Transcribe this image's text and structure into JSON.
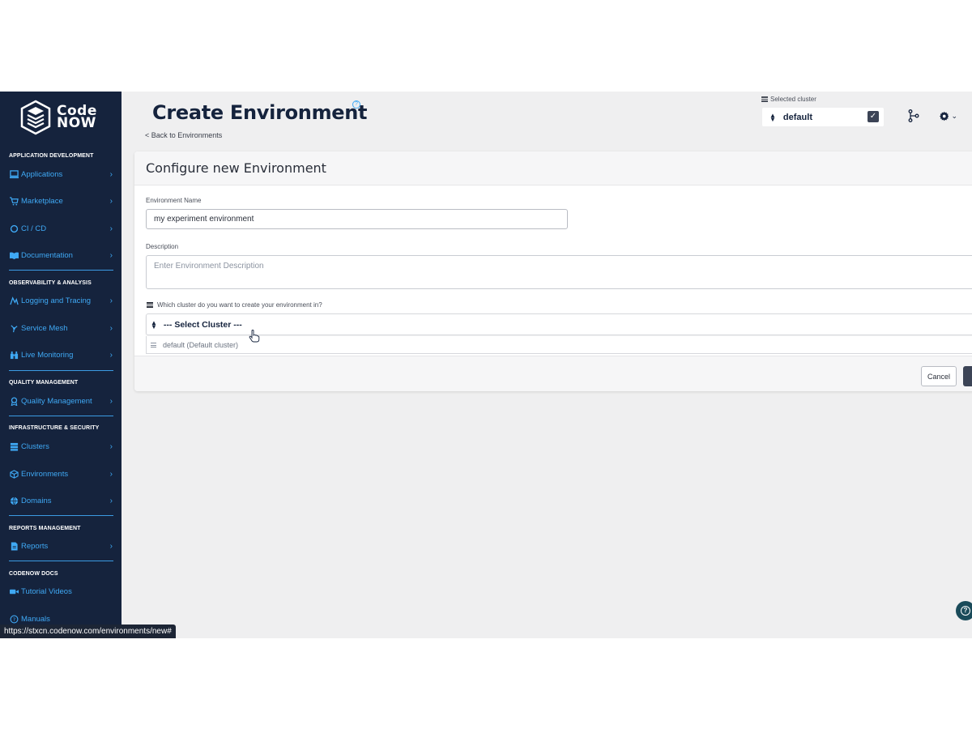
{
  "brand": {
    "line1": "Code",
    "line2": "NOW"
  },
  "sidebar": {
    "sections": [
      {
        "title": "APPLICATION DEVELOPMENT"
      },
      {
        "title": "OBSERVABILITY & ANALYSIS"
      },
      {
        "title": "QUALITY MANAGEMENT"
      },
      {
        "title": "INFRASTRUCTURE & SECURITY"
      },
      {
        "title": "REPORTS MANAGEMENT"
      },
      {
        "title": "CODENOW DOCS"
      }
    ],
    "items": [
      {
        "label": "Applications",
        "icon": "applications-icon"
      },
      {
        "label": "Marketplace",
        "icon": "cart-icon"
      },
      {
        "label": "CI / CD",
        "icon": "cicd-icon"
      },
      {
        "label": "Documentation",
        "icon": "book-icon"
      },
      {
        "label": "Logging and Tracing",
        "icon": "logging-icon"
      },
      {
        "label": "Service Mesh",
        "icon": "mesh-icon"
      },
      {
        "label": "Live Monitoring",
        "icon": "binoculars-icon"
      },
      {
        "label": "Quality Management",
        "icon": "quality-icon"
      },
      {
        "label": "Clusters",
        "icon": "server-icon"
      },
      {
        "label": "Environments",
        "icon": "box-icon"
      },
      {
        "label": "Domains",
        "icon": "globe-icon"
      },
      {
        "label": "Reports",
        "icon": "report-icon"
      },
      {
        "label": "Tutorial Videos",
        "icon": "video-icon"
      },
      {
        "label": "Manuals",
        "icon": "help-circle-icon"
      }
    ]
  },
  "header": {
    "title": "Create Environment",
    "back_link": "< Back to Environments",
    "cluster_label": "Selected cluster",
    "cluster_value": "default"
  },
  "form": {
    "card_title": "Configure new Environment",
    "name_label": "Environment Name",
    "name_value": "my experiment environment",
    "description_label": "Description",
    "description_placeholder": "Enter Environment Description",
    "cluster_question": "Which cluster do you want to create your environment in?",
    "cluster_select": "--- Select Cluster ---",
    "cluster_option": "default (Default cluster)",
    "cancel_label": "Cancel"
  },
  "status_bar": {
    "url": "https://stxcn.codenow.com/environments/new#"
  },
  "colors": {
    "sidebar_bg": "#15233d",
    "accent": "#3fa9f5",
    "button_dark": "#3c4456"
  }
}
